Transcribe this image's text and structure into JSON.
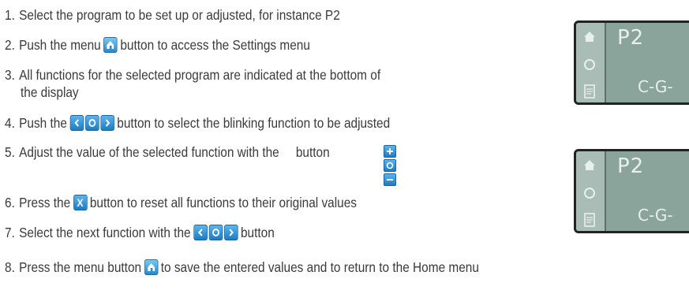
{
  "steps": [
    {
      "num": "1.",
      "text": "Select the program to be set up or adjusted, for instance P2"
    },
    {
      "num": "2.",
      "pre": "Push the menu",
      "post": "button to access the Settings menu",
      "icon": "menu-home-icon"
    },
    {
      "num": "3.",
      "text": "All functions for the selected program are indicated at the bottom of",
      "text2": "the display"
    },
    {
      "num": "4.",
      "pre": "Push the",
      "post": "button to select the blinking function to be adjusted",
      "icon": "left-ok-right-icons"
    },
    {
      "num": "5.",
      "pre": "Adjust the value of the selected function with the",
      "post": "button",
      "icon": "plus-ok-minus-icons"
    },
    {
      "num": "6.",
      "pre": "Press the",
      "post": "button to reset all functions to their original values",
      "icon": "x-icon"
    },
    {
      "num": "7.",
      "pre": "Select the next function with the",
      "post": "button",
      "icon": "left-ok-right-icons"
    },
    {
      "num": "8.",
      "pre": "Press the menu button",
      "post": "to save the entered values and to return to the Home menu",
      "icon": "menu-home-icon"
    }
  ],
  "display_top": {
    "program": "P2",
    "functions": "C-G-"
  },
  "display_bottom": {
    "program": "P2",
    "functions": "C-G-"
  },
  "colors": {
    "text": "#3a3a3a",
    "button_blue": "#2a88c8",
    "lcd": "#8aa39b"
  }
}
